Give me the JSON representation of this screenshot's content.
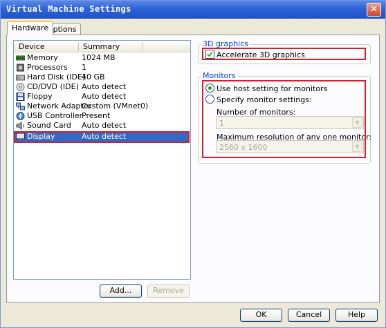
{
  "window": {
    "title": "Virtual Machine Settings",
    "close_label": "✕"
  },
  "tabs": [
    {
      "label": "Hardware"
    },
    {
      "label": "Options"
    }
  ],
  "device_list": {
    "columns": {
      "device": "Device",
      "summary": "Summary"
    },
    "rows": [
      {
        "device": "Memory",
        "summary": "1024 MB",
        "icon": "memory-icon"
      },
      {
        "device": "Processors",
        "summary": "1",
        "icon": "processor-icon"
      },
      {
        "device": "Hard Disk (IDE)",
        "summary": "40 GB",
        "icon": "hard-disk-icon"
      },
      {
        "device": "CD/DVD (IDE)",
        "summary": "Auto detect",
        "icon": "cd-dvd-icon"
      },
      {
        "device": "Floppy",
        "summary": "Auto detect",
        "icon": "floppy-icon"
      },
      {
        "device": "Network Adapter",
        "summary": "Custom (VMnet0)",
        "icon": "network-adapter-icon"
      },
      {
        "device": "USB Controller",
        "summary": "Present",
        "icon": "usb-icon"
      },
      {
        "device": "Sound Card",
        "summary": "Auto detect",
        "icon": "sound-card-icon"
      },
      {
        "device": "Display",
        "summary": "Auto detect",
        "icon": "display-icon",
        "selected": true
      }
    ]
  },
  "buttons": {
    "add": "Add...",
    "remove": "Remove",
    "ok": "OK",
    "cancel": "Cancel",
    "help": "Help"
  },
  "graphics_3d": {
    "group_label": "3D graphics",
    "accelerate_label": "Accelerate 3D graphics",
    "accelerate_checked": true
  },
  "monitors": {
    "group_label": "Monitors",
    "use_host_label": "Use host setting for monitors",
    "specify_label": "Specify monitor settings:",
    "selected_option": "use_host",
    "number_label": "Number of monitors:",
    "number_value": "1",
    "max_res_label": "Maximum resolution of any one monitor:",
    "max_res_value": "2560 x 1600"
  },
  "colors": {
    "highlight_box": "#d4202a",
    "selection": "#316ac5",
    "group_label": "#0046d5"
  }
}
